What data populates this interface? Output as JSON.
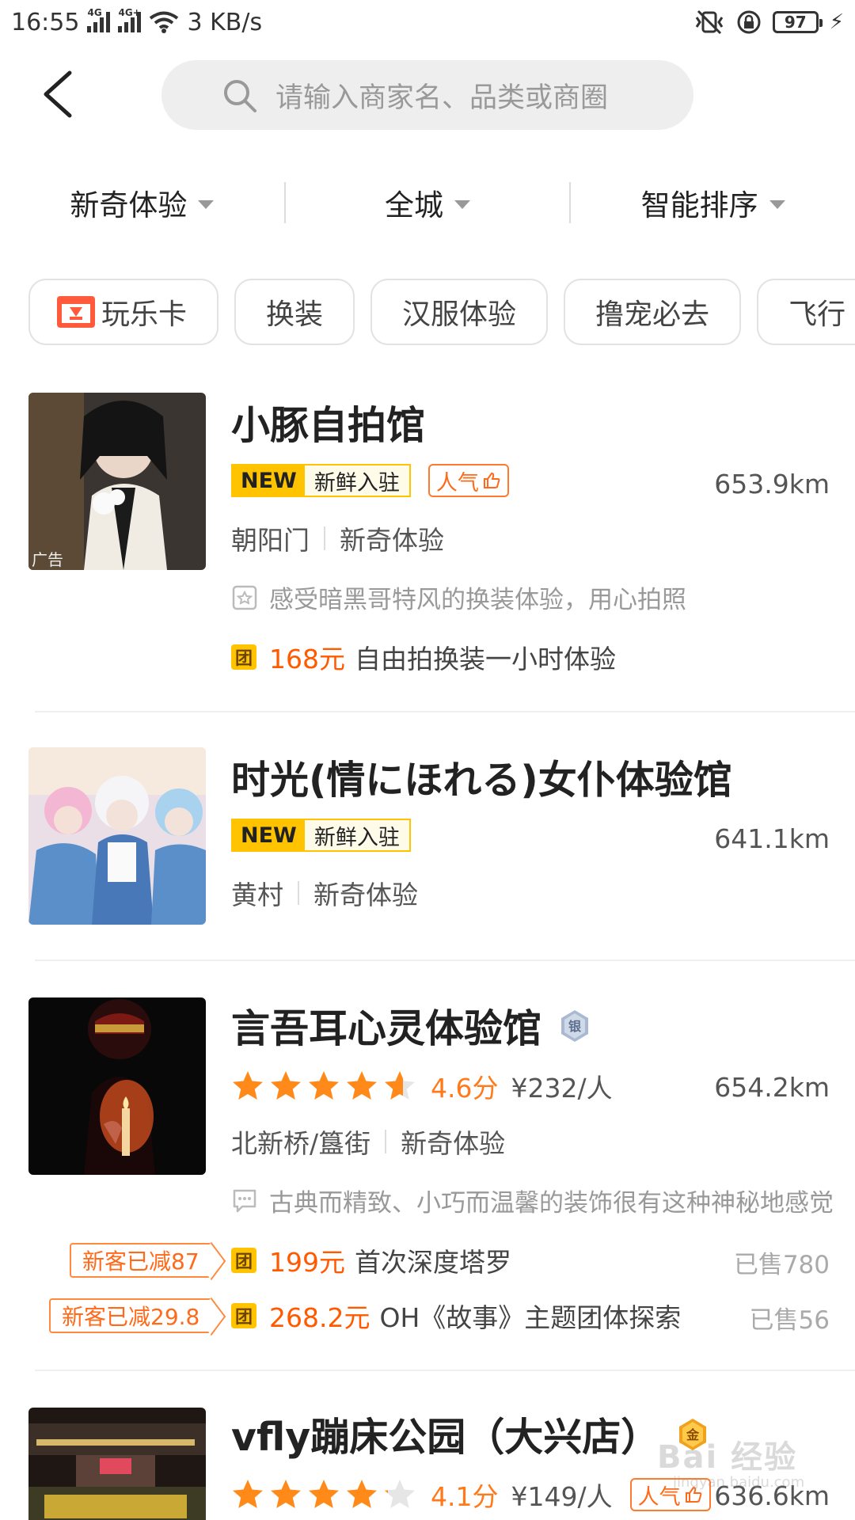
{
  "status": {
    "time": "16:55",
    "net1": "4G",
    "net2": "4G+",
    "speed": "3 KB/s",
    "battery": "97"
  },
  "search": {
    "placeholder": "请输入商家名、品类或商圈"
  },
  "filters": [
    {
      "label": "新奇体验"
    },
    {
      "label": "全城"
    },
    {
      "label": "智能排序"
    }
  ],
  "chips": [
    "玩乐卡",
    "换装",
    "汉服体验",
    "撸宠必去",
    "飞行"
  ],
  "listings": [
    {
      "title": "小豚自拍馆",
      "ad": "广告",
      "new_label": "NEW",
      "new_text": "新鲜入驻",
      "hot_label": "人气",
      "distance": "653.9km",
      "area": "朝阳门",
      "category": "新奇体验",
      "review": "感受暗黑哥特风的换装体验，用心拍照",
      "deals": [
        {
          "tag": "团",
          "price": "168元",
          "name": "自由拍换装一小时体验"
        }
      ]
    },
    {
      "title": "时光(情にほれる)女仆体验馆",
      "new_label": "NEW",
      "new_text": "新鲜入驻",
      "distance": "641.1km",
      "area": "黄村",
      "category": "新奇体验"
    },
    {
      "title": "言吾耳心灵体验馆",
      "medal": "银",
      "rating": 4.6,
      "score": "4.6分",
      "avg_price": "¥232/人",
      "distance": "654.2km",
      "area": "北新桥/簋街",
      "category": "新奇体验",
      "review": "古典而精致、小巧而温馨的装饰很有这种神秘地感觉",
      "deals": [
        {
          "promo": "新客已减87",
          "tag": "团",
          "price": "199元",
          "name": "首次深度塔罗",
          "sold": "已售780"
        },
        {
          "promo": "新客已减29.8",
          "tag": "团",
          "price": "268.2元",
          "name": "OH《故事》主题团体探索",
          "sold": "已售56"
        }
      ]
    },
    {
      "title": "vfly蹦床公园（大兴店）",
      "medal": "金",
      "rating": 4.1,
      "score": "4.1分",
      "avg_price": "¥149/人",
      "hot_label": "人气",
      "distance": "636.6km"
    }
  ],
  "watermark": {
    "main": "Bai 经验",
    "sub": "jingyan.baidu.com"
  }
}
